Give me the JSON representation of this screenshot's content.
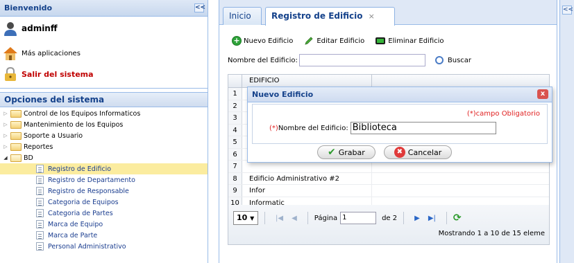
{
  "left_panel": {
    "title": "Bienvenido",
    "collapse_label": "<<",
    "username": "adminff",
    "more_apps": "Más aplicaciones",
    "logout": "Salir del sistema",
    "options_title": "Opciones del sistema",
    "tree": [
      {
        "label": "Control de los Equipos Informaticos"
      },
      {
        "label": "Mantenimiento de los Equipos"
      },
      {
        "label": "Soporte a Usuario"
      },
      {
        "label": "Reportes"
      },
      {
        "label": "BD"
      }
    ],
    "bd_children": [
      {
        "label": "Registro de Edificio"
      },
      {
        "label": "Registro de Departamento"
      },
      {
        "label": "Registro de Responsable"
      },
      {
        "label": "Categoria de Equipos"
      },
      {
        "label": "Categoria de Partes"
      },
      {
        "label": "Marca de Equipo"
      },
      {
        "label": "Marca de Parte"
      },
      {
        "label": "Personal Administrativo"
      }
    ]
  },
  "tabs": {
    "inicio": "Inicio",
    "registro": "Registro de Edificio",
    "close": "×"
  },
  "toolbar": {
    "new": "Nuevo Edificio",
    "edit": "Editar Edificio",
    "delete": "Eliminar Edificio"
  },
  "search": {
    "label": "Nombre del Edificio:",
    "value": "",
    "button": "Buscar"
  },
  "grid": {
    "column": "EDIFICIO",
    "rows": [
      {
        "n": "1",
        "v": ""
      },
      {
        "n": "2",
        "v": ""
      },
      {
        "n": "3",
        "v": ""
      },
      {
        "n": "4",
        "v": ""
      },
      {
        "n": "5",
        "v": ""
      },
      {
        "n": "6",
        "v": ""
      },
      {
        "n": "7",
        "v": ""
      },
      {
        "n": "8",
        "v": "Edificio Administrativo #2"
      },
      {
        "n": "9",
        "v": "Infor"
      },
      {
        "n": "10",
        "v": "Informatic"
      }
    ]
  },
  "pager": {
    "page_size": "10",
    "page_label": "Página",
    "page_value": "1",
    "of": "de 2",
    "info": "Mostrando 1 a 10 de 15 eleme"
  },
  "dialog": {
    "title": "Nuevo Edificio",
    "required_note": "(*)campo Obligatorio",
    "field_mark": "(*)",
    "field_label": "Nombre del Edificio:",
    "field_value": "Biblioteca",
    "save": "Grabar",
    "cancel": "Cancelar",
    "close": "x"
  },
  "right_strip": {
    "collapse_label": "<<"
  }
}
